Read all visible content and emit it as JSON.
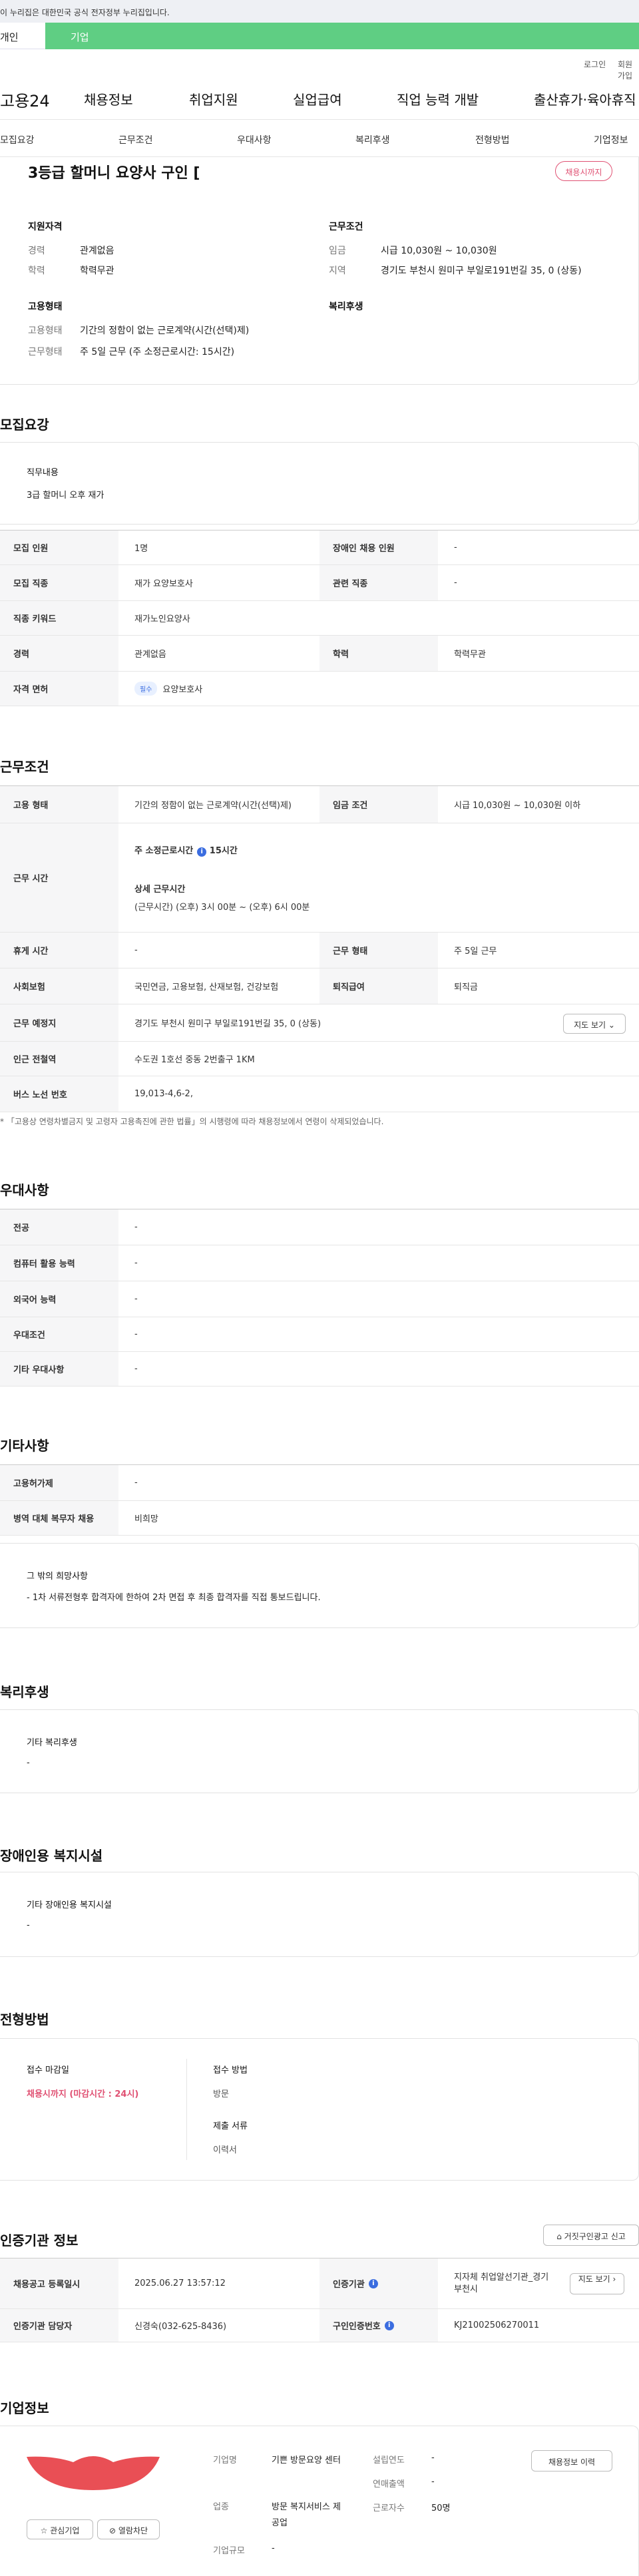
{
  "gov_banner": "이 누리집은 대한민국 공식 전자정부 누리집입니다.",
  "toggle": {
    "left": "개인",
    "right": "기업"
  },
  "util": {
    "login": "로그인",
    "join": "회원가입"
  },
  "gnb": {
    "logo": "고용24",
    "items": [
      "채용정보",
      "취업지원",
      "실업급여",
      "직업 능력 개발",
      "출산휴가·육아휴직"
    ]
  },
  "subnav": [
    "모집요강",
    "근무조건",
    "우대사항",
    "복리후생",
    "전형방법",
    "기업정보"
  ],
  "summary": {
    "title": "3등급 할머니 요양사 구인 [",
    "deadline_pill": "채용시까지",
    "qual_heading": "지원자격",
    "career_label": "경력",
    "career_value": "관계없음",
    "edu_label": "학력",
    "edu_value": "학력무관",
    "work_heading": "근무조건",
    "wage_label": "임금",
    "wage_value": "시급 10,030원 ~ 10,030원",
    "region_label": "지역",
    "region_value": "경기도 부천시 원미구 부일로191번길 35, 0 (상동)",
    "emp_heading": "고용형태",
    "emp_type_label": "고용형태",
    "emp_type_value": "기간의 정함이 없는 근로계약(시간(선택)제)",
    "work_form_label": "근무형태",
    "work_form_value": "주 5일 근무 (주 소정근로시간: 15시간)",
    "welfare_heading": "복리후생"
  },
  "recruit": {
    "title": "모집요강",
    "duty_label": "직무내용",
    "duty_value": "3급 할머니 오후 재가",
    "rows": {
      "headcount_label": "모집 인원",
      "headcount": "1명",
      "disabled_label": "장애인 채용 인원",
      "disabled": "-",
      "job_label": "모집 직종",
      "job": "재가 요양보호사",
      "related_label": "관련 직종",
      "related": "-",
      "keyword_label": "직종 키워드",
      "keyword": "재가노인요양사",
      "career_label": "경력",
      "career": "관계없음",
      "edu_label": "학력",
      "edu": "학력무관",
      "license_label": "자격 면허",
      "license_badge": "필수",
      "license": "요양보호사"
    }
  },
  "conditions": {
    "title": "근무조건",
    "emp_label": "고용 형태",
    "emp": "기간의 정함이 없는 근로계약(시간(선택)제)",
    "wage_label": "임금 조건",
    "wage": "시급 10,030원 ~ 10,030원 이하",
    "hours_label": "근무 시간",
    "hours_main": "주 소정근로시간",
    "hours_main_value": "15시간",
    "hours_detail_title": "상세 근무시간",
    "hours_detail": "(근무시간) (오후) 3시 00분 ~ (오후) 6시 00분",
    "rest_label": "휴게 시간",
    "rest": "-",
    "form_label": "근무 형태",
    "form": "주 5일 근무",
    "insurance_label": "사회보험",
    "insurance": "국민연금, 고용보험, 산재보험, 건강보험",
    "severance_label": "퇴직급여",
    "severance": "퇴직금",
    "place_label": "근무 예정지",
    "place": "경기도 부천시 원미구 부일로191번길 35, 0 (상동)",
    "map_btn": "지도 보기",
    "station_label": "인근 전철역",
    "station": "수도권 1호선 중동 2번출구 1KM",
    "bus_label": "버스 노선 번호",
    "bus": "19,013-4,6-2,",
    "note": "「고용상 연령차별금지 및 고령자 고용촉진에 관한 법률」의 시행령에 따라 채용정보에서 연령이 삭제되었습니다."
  },
  "preference": {
    "title": "우대사항",
    "major_label": "전공",
    "major": "-",
    "pc_label": "컴퓨터 활용 능력",
    "pc": "-",
    "lang_label": "외국어 능력",
    "lang": "-",
    "cond_label": "우대조건",
    "cond": "-",
    "other_label": "기타 우대사항",
    "other": "-"
  },
  "etc": {
    "title": "기타사항",
    "subsidy_label": "고용허가제",
    "subsidy": "-",
    "military_label": "병역 대체 복무자 채용",
    "military": "비희망",
    "box_title": "그 밖의 희망사항",
    "box_text": "- 1차 서류전형후 합격자에 한하여 2차 면접 후 최종 합격자를 직접 통보드립니다."
  },
  "welfare": {
    "title": "복리후생",
    "box_title": "기타 복리후생",
    "box_value": "-"
  },
  "facility": {
    "title": "장애인용 복지시설",
    "box_title": "기타 장애인용 복지시설",
    "box_value": "-"
  },
  "selection": {
    "title": "전형방법",
    "deadline_label": "접수 마감일",
    "deadline": "채용시까지 (마감시간 : 24시)",
    "method_label": "접수 방법",
    "method": "방문",
    "docs_label": "제출 서류",
    "docs": "이력서"
  },
  "cert": {
    "title": "인증기관 정보",
    "report_btn": "거짓구인광고 신고",
    "reg_label": "채용공고 등록일시",
    "reg": "2025.06.27 13:57:12",
    "org_label": "인증기관",
    "org": "지자체 취업알선기관_경기 부천시",
    "map_btn": "지도 보기",
    "manager_label": "인증기관 담당자",
    "manager": "신경숙(032-625-8436)",
    "no_label": "구인인증번호",
    "no": "KJ21002506270011"
  },
  "company": {
    "title": "기업정보",
    "fav_btn": "관심기업",
    "block_btn": "열람차단",
    "name_label": "기업명",
    "name": "기쁜 방문요양 센터",
    "industry_label": "업종",
    "industry": "방문 복지서비스 제공업",
    "size_label": "기업규모",
    "size": "-",
    "founded_label": "설립연도",
    "founded": "-",
    "sales_label": "연매출액",
    "sales": "-",
    "staff_label": "근로자수",
    "staff": "50명",
    "history_btn": "채용정보 이력"
  },
  "colors": {
    "accent_green": "#5fce83",
    "accent_red": "#e05173",
    "logo_red": "#e94f55",
    "blue": "#3b6de0"
  }
}
